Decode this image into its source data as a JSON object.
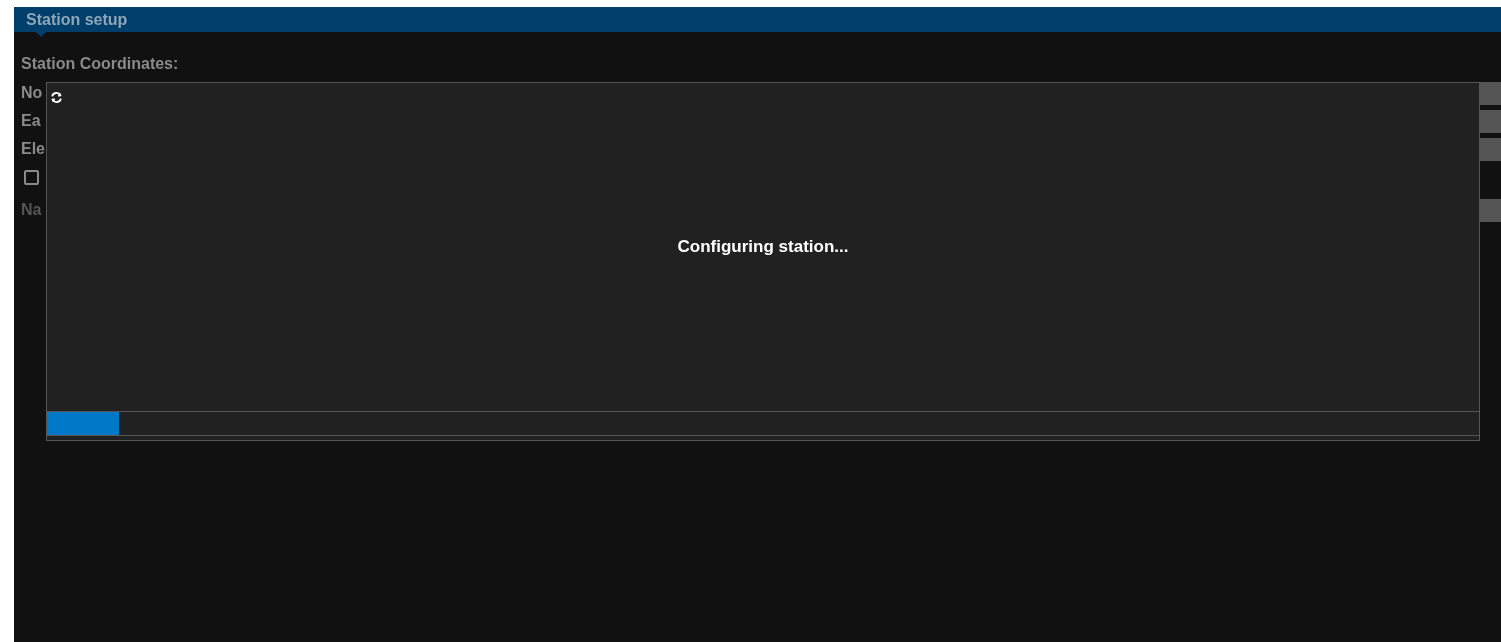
{
  "panel": {
    "title": "Station setup"
  },
  "section_title": "Station Coordinates:",
  "rows": [
    {
      "kind": "field",
      "label": "No",
      "disabled": false
    },
    {
      "kind": "field",
      "label": "Ea",
      "disabled": false
    },
    {
      "kind": "field",
      "label": "Ele",
      "disabled": false
    },
    {
      "kind": "checkbox",
      "checked": false
    },
    {
      "kind": "field",
      "label": "Na",
      "disabled": true
    }
  ],
  "overlay": {
    "message": "Configuring station...",
    "progress": {
      "level": 0.05
    }
  }
}
